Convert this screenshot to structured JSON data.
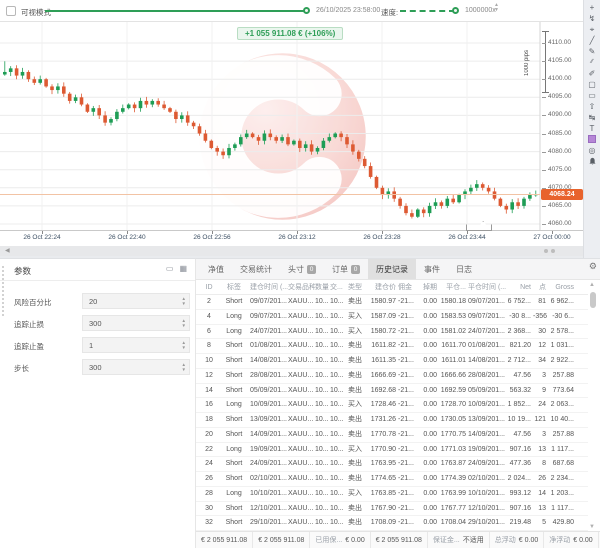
{
  "topbar": {
    "visual_mode_label": "可视模式",
    "datetime": "26/10/2025 23:58:00",
    "speed_label": "速度:",
    "speed_value": "1000000x"
  },
  "chart": {
    "banner": "+1 055 911.08 € (+106%)",
    "pips_scale": "1000 pips",
    "price_tag": "4068.24",
    "current_price": 4068.24,
    "price_ticks": [
      "4110.00",
      "4105.00",
      "4100.00",
      "4095.00",
      "4090.00",
      "4085.00",
      "4080.00",
      "4075.00",
      "4070.00",
      "4065.00",
      "4060.00"
    ],
    "time_ticks": [
      "26 Oct 22:24",
      "26 Oct 22:40",
      "26 Oct 22:56",
      "26 Oct 23:12",
      "26 Oct 23:28",
      "26 Oct 23:44",
      "27 Oct 00:00"
    ],
    "candles_close": [
      4102,
      4103,
      4101,
      4102,
      4100,
      4099,
      4100,
      4098,
      4097,
      4098,
      4096,
      4094,
      4095,
      4093,
      4091,
      4092,
      4090,
      4088,
      4089,
      4091,
      4092,
      4093,
      4092,
      4094,
      4093,
      4094,
      4093,
      4092,
      4091,
      4089,
      4090,
      4088,
      4087,
      4085,
      4083,
      4081,
      4080,
      4079,
      4081,
      4082,
      4084,
      4085,
      4084,
      4083,
      4085,
      4084,
      4083,
      4084,
      4082,
      4083,
      4081,
      4082,
      4080,
      4081,
      4083,
      4084,
      4085,
      4084,
      4082,
      4080,
      4078,
      4076,
      4073,
      4070,
      4068,
      4069,
      4067,
      4065,
      4063,
      4062,
      4064,
      4063,
      4065,
      4066,
      4065,
      4067,
      4066,
      4068,
      4069,
      4070,
      4071,
      4070,
      4069,
      4067,
      4065,
      4064,
      4066,
      4065,
      4067,
      4068,
      4068.24
    ],
    "colors": {
      "up": "#1e9d55",
      "down": "#dd5a33",
      "grid": "#ececec",
      "price_line": "#f2c3a4",
      "price_tag_bg": "#e8632d"
    }
  },
  "right_toolbar": {
    "icons": [
      {
        "name": "add-icon",
        "glyph": "+"
      },
      {
        "name": "cursor-lightning-icon",
        "glyph": "↯"
      },
      {
        "name": "crosshair-icon",
        "glyph": "⌖"
      },
      {
        "name": "trendline-icon",
        "glyph": "╱"
      },
      {
        "name": "pencil-icon",
        "glyph": "✎"
      },
      {
        "name": "multi-line-icon",
        "glyph": "∕∕"
      },
      {
        "name": "pen-icon",
        "glyph": "✐"
      },
      {
        "name": "dashed-rect-icon",
        "glyph": "▢"
      },
      {
        "name": "rectangle-icon",
        "glyph": "▭"
      },
      {
        "name": "arrow-shape-icon",
        "glyph": "⇧"
      },
      {
        "name": "fib-channel-icon",
        "glyph": "↹"
      },
      {
        "name": "text-tool-icon",
        "glyph": "T"
      },
      {
        "name": "color-swatch-icon",
        "glyph": "swatch"
      },
      {
        "name": "ellipse-icon",
        "glyph": "◎"
      },
      {
        "name": "bell-icon",
        "glyph": "bell"
      }
    ]
  },
  "parameters": {
    "title": "参数",
    "fields": [
      {
        "label": "风险百分比",
        "value": "20"
      },
      {
        "label": "追踪止损",
        "value": "300"
      },
      {
        "label": "追踪止盈",
        "value": "1"
      },
      {
        "label": "步长",
        "value": "300"
      }
    ]
  },
  "tabs": [
    {
      "label": "净值"
    },
    {
      "label": "交易统计"
    },
    {
      "label": "头寸",
      "badge": "0"
    },
    {
      "label": "订单",
      "badge": "0"
    },
    {
      "label": "历史记录",
      "active": true
    },
    {
      "label": "事件"
    },
    {
      "label": "日志"
    }
  ],
  "history_table": {
    "columns": [
      "ID",
      "标签",
      "建仓时间 (...",
      "交易品种",
      "数量",
      "交...",
      "类型",
      "建仓价",
      "佣金",
      "掉期",
      "平仓...",
      "平仓时间 (...",
      "Net",
      "点",
      "Gross"
    ],
    "rows": [
      [
        "2",
        "Short",
        "09/07/201...",
        "XAUU...",
        "10...",
        "10...",
        "卖出",
        "1580.97",
        "-21...",
        "0.00",
        "1580.18",
        "09/07/201...",
        "6 752...",
        "81",
        "6 962..."
      ],
      [
        "4",
        "Long",
        "09/07/201...",
        "XAUU...",
        "10...",
        "10...",
        "买入",
        "1587.09",
        "-21...",
        "0.00",
        "1583.53",
        "09/07/201...",
        "-30 8...",
        "-356",
        "-30 6..."
      ],
      [
        "6",
        "Long",
        "24/07/201...",
        "XAUU...",
        "10...",
        "10...",
        "买入",
        "1580.72",
        "-21...",
        "0.00",
        "1581.02",
        "24/07/201...",
        "2 368...",
        "30",
        "2 578..."
      ],
      [
        "8",
        "Short",
        "01/08/201...",
        "XAUU...",
        "10...",
        "10...",
        "卖出",
        "1611.82",
        "-21...",
        "0.00",
        "1611.70",
        "01/08/201...",
        "821.20",
        "12",
        "1 031..."
      ],
      [
        "10",
        "Short",
        "14/08/201...",
        "XAUU...",
        "10...",
        "10...",
        "卖出",
        "1611.35",
        "-21...",
        "0.00",
        "1611.01",
        "14/08/201...",
        "2 712...",
        "34",
        "2 922..."
      ],
      [
        "12",
        "Short",
        "28/08/201...",
        "XAUU...",
        "10...",
        "10...",
        "卖出",
        "1666.69",
        "-21...",
        "0.00",
        "1666.66",
        "28/08/201...",
        "47.56",
        "3",
        "257.88"
      ],
      [
        "14",
        "Short",
        "05/09/201...",
        "XAUU...",
        "10...",
        "10...",
        "卖出",
        "1692.68",
        "-21...",
        "0.00",
        "1692.59",
        "05/09/201...",
        "563.32",
        "9",
        "773.64"
      ],
      [
        "16",
        "Long",
        "10/09/201...",
        "XAUU...",
        "10...",
        "10...",
        "买入",
        "1728.46",
        "-21...",
        "0.00",
        "1728.70",
        "10/09/201...",
        "1 852...",
        "24",
        "2 063..."
      ],
      [
        "18",
        "Short",
        "13/09/201...",
        "XAUU...",
        "10...",
        "10...",
        "卖出",
        "1731.26",
        "-21...",
        "0.00",
        "1730.05",
        "13/09/201...",
        "10 19...",
        "121",
        "10 40..."
      ],
      [
        "20",
        "Short",
        "14/09/201...",
        "XAUU...",
        "10...",
        "10...",
        "卖出",
        "1770.78",
        "-21...",
        "0.00",
        "1770.75",
        "14/09/201...",
        "47.56",
        "3",
        "257.88"
      ],
      [
        "22",
        "Long",
        "19/09/201...",
        "XAUU...",
        "10...",
        "10...",
        "买入",
        "1770.90",
        "-21...",
        "0.00",
        "1771.03",
        "19/09/201...",
        "907.16",
        "13",
        "1 117..."
      ],
      [
        "24",
        "Short",
        "24/09/201...",
        "XAUU...",
        "10...",
        "10...",
        "卖出",
        "1763.95",
        "-21...",
        "0.00",
        "1763.87",
        "24/09/201...",
        "477.36",
        "8",
        "687.68"
      ],
      [
        "26",
        "Short",
        "02/10/201...",
        "XAUU...",
        "10...",
        "10...",
        "卖出",
        "1774.65",
        "-21...",
        "0.00",
        "1774.39",
        "02/10/201...",
        "2 024...",
        "26",
        "2 234..."
      ],
      [
        "28",
        "Long",
        "10/10/201...",
        "XAUU...",
        "10...",
        "10...",
        "买入",
        "1763.85",
        "-21...",
        "0.00",
        "1763.99",
        "10/10/201...",
        "993.12",
        "14",
        "1 203..."
      ],
      [
        "30",
        "Short",
        "12/10/201...",
        "XAUU...",
        "10...",
        "10...",
        "卖出",
        "1767.90",
        "-21...",
        "0.00",
        "1767.77",
        "12/10/201...",
        "907.16",
        "13",
        "1 117..."
      ],
      [
        "32",
        "Short",
        "29/10/201...",
        "XAUU...",
        "10...",
        "10...",
        "卖出",
        "1708.09",
        "-21...",
        "0.00",
        "1708.04",
        "29/10/201...",
        "219.48",
        "5",
        "429.80"
      ]
    ]
  },
  "status_bar": {
    "segments": [
      {
        "label": "",
        "value": "€ 2 055 911.08"
      },
      {
        "label": "",
        "value": "€ 2 055 911.08"
      },
      {
        "label": "已用保...",
        "value": "€ 0.00"
      },
      {
        "label": "",
        "value": "€ 2 055 911.08"
      },
      {
        "label": "保证金...",
        "value": "不适用"
      },
      {
        "label": "总浮动",
        "value": "€ 0.00"
      },
      {
        "label": "净浮动",
        "value": "€ 0.00"
      }
    ]
  },
  "icons": {
    "up_arrow": "▲",
    "down_arrow": "▼",
    "left_arrow": "◀",
    "gear": "⚙",
    "spinner_up": "▲",
    "spinner_down": "▼",
    "window_icon": "▭",
    "grid_icon": "▦"
  }
}
